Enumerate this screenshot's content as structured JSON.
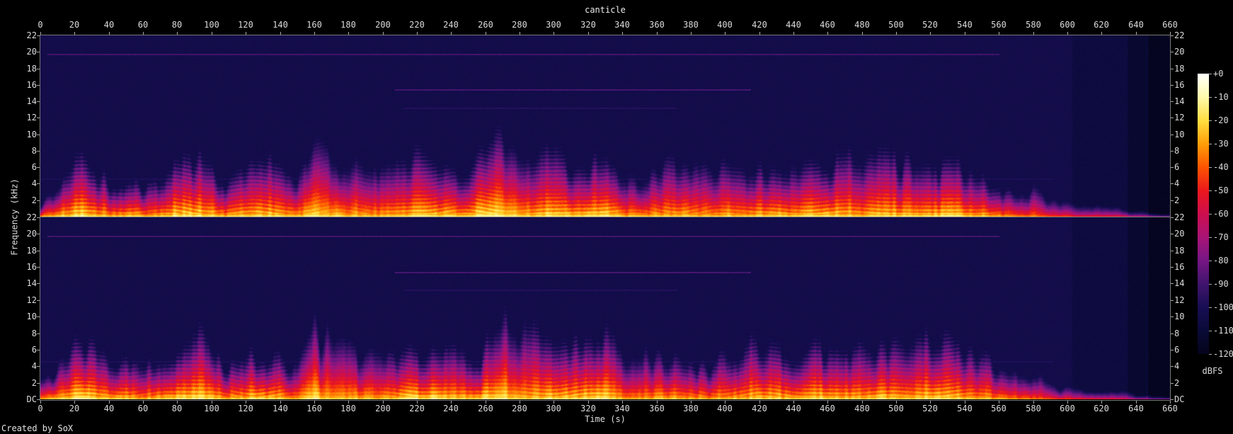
{
  "title": "canticle",
  "footer": {
    "credit": "Created by SoX"
  },
  "axes": {
    "time": {
      "label": "Time (s)",
      "min_s": 0,
      "max_s": 660,
      "tick_step_s": 20
    },
    "freq": {
      "label": "Frequency (kHz)",
      "ticks_khz": [
        22,
        20,
        18,
        16,
        14,
        12,
        10,
        8,
        6,
        4,
        2
      ],
      "dc_label": "DC",
      "max_khz": 22
    },
    "colorbar": {
      "label": "dBFS",
      "tick_labels": [
        "+0",
        "-10",
        "-20",
        "-30",
        "-40",
        "-50",
        "-60",
        "-70",
        "-80",
        "-90",
        "-100",
        "-110",
        "-120"
      ],
      "max_db": 0,
      "min_db": -120
    }
  },
  "colors": {
    "background": "#000000",
    "plot_background": "#0d0c4a",
    "axis_line": "#787878",
    "tick": "#a8a8a8",
    "label_text": "#dcdcdc"
  },
  "chart_data": {
    "type": "heatmap",
    "subtype": "stereo_spectrogram",
    "title": "canticle",
    "xlabel": "Time (s)",
    "ylabel": "Frequency (kHz)",
    "x_range_s": [
      0,
      660
    ],
    "x_tick_step_s": 20,
    "freq_range_khz": [
      0,
      22
    ],
    "freq_tick_step_khz": 2,
    "channels": 2,
    "level_range_dbfs": [
      -120,
      0
    ],
    "palette_anchors_db_rgb": [
      [
        0,
        255,
        255,
        252
      ],
      [
        -10,
        255,
        249,
        170
      ],
      [
        -20,
        255,
        222,
        65
      ],
      [
        -30,
        255,
        158,
        8
      ],
      [
        -40,
        252,
        84,
        2
      ],
      [
        -50,
        234,
        24,
        28
      ],
      [
        -60,
        205,
        14,
        78
      ],
      [
        -70,
        168,
        20,
        118
      ],
      [
        -80,
        118,
        22,
        132
      ],
      [
        -90,
        64,
        20,
        108
      ],
      [
        -100,
        24,
        14,
        84
      ],
      [
        -110,
        10,
        10,
        56
      ],
      [
        -120,
        4,
        4,
        28
      ]
    ],
    "background_level_db": -103.5,
    "envelope_t_step_s": 10,
    "amp": [
      0.55,
      0.65,
      0.8,
      0.8,
      0.65,
      0.7,
      0.62,
      0.7,
      0.78,
      0.78,
      0.7,
      0.64,
      0.72,
      0.77,
      0.7,
      0.62,
      0.8,
      0.72,
      0.66,
      0.66,
      0.62,
      0.7,
      0.78,
      0.78,
      0.68,
      0.73,
      0.78,
      0.78,
      0.7,
      0.73,
      0.78,
      0.74,
      0.77,
      0.8,
      0.62,
      0.6,
      0.64,
      0.68,
      0.64,
      0.6,
      0.68,
      0.64,
      0.72,
      0.72,
      0.66,
      0.74,
      0.76,
      0.7,
      0.66,
      0.72,
      0.72,
      0.66,
      0.75,
      0.75,
      0.7,
      0.64,
      0.56,
      0.5,
      0.45,
      0.33,
      0.28,
      0.26,
      0.24,
      0.2,
      0.1,
      0.06,
      0.05
    ],
    "extent_khz": [
      2.5,
      4,
      6.5,
      7,
      5,
      5.5,
      4.2,
      5,
      6.8,
      7,
      6,
      5,
      6,
      6.5,
      6,
      5,
      9.5,
      8.5,
      7.5,
      7.5,
      7,
      6.5,
      7,
      7,
      6,
      6.5,
      7,
      10,
      9,
      8,
      8,
      7,
      7.5,
      8,
      6,
      6,
      6.5,
      7,
      6.5,
      6,
      7,
      6.5,
      7,
      7,
      6.5,
      7,
      7.5,
      7,
      6.5,
      7,
      7,
      6.5,
      7,
      7,
      6.5,
      6,
      5,
      4.5,
      4,
      3,
      2.5,
      2.5,
      2,
      2,
      1.5,
      1,
      1
    ],
    "stripe": [
      0.1,
      0.3,
      0.8,
      0.85,
      0.5,
      0.7,
      0.5,
      0.6,
      0.8,
      0.8,
      0.6,
      0.6,
      0.75,
      0.8,
      0.65,
      0.5,
      0.35,
      0.3,
      0.35,
      0.4,
      0.45,
      0.7,
      0.8,
      0.8,
      0.6,
      0.75,
      0.8,
      0.45,
      0.4,
      0.7,
      0.8,
      0.75,
      0.8,
      0.7,
      0.5,
      0.35,
      0.45,
      0.6,
      0.5,
      0.45,
      0.6,
      0.55,
      0.75,
      0.75,
      0.6,
      0.8,
      0.8,
      0.7,
      0.65,
      0.75,
      0.75,
      0.6,
      0.8,
      0.8,
      0.7,
      0.6,
      0.4,
      0.3,
      0.25,
      0.1,
      0.05,
      0.05,
      0,
      0,
      0,
      0,
      0
    ],
    "hf_lines": [
      {
        "khz": 19.7,
        "t0_s": 4,
        "t1_s": 560,
        "db": -90
      },
      {
        "khz": 15.4,
        "t0_s": 207,
        "t1_s": 415,
        "db": -89
      },
      {
        "khz": 13.2,
        "t0_s": 212,
        "t1_s": 372,
        "db": -97
      },
      {
        "khz": 4.6,
        "t0_s": 0,
        "t1_s": 592,
        "db": -99
      }
    ],
    "quiet_zones": [
      {
        "t0_s": 602,
        "t1_s": 634,
        "db_drop": 4
      },
      {
        "t0_s": 634,
        "t1_s": 646,
        "db_drop": 9
      },
      {
        "t0_s": 646,
        "t1_s": 660,
        "db_drop": 15
      }
    ]
  }
}
